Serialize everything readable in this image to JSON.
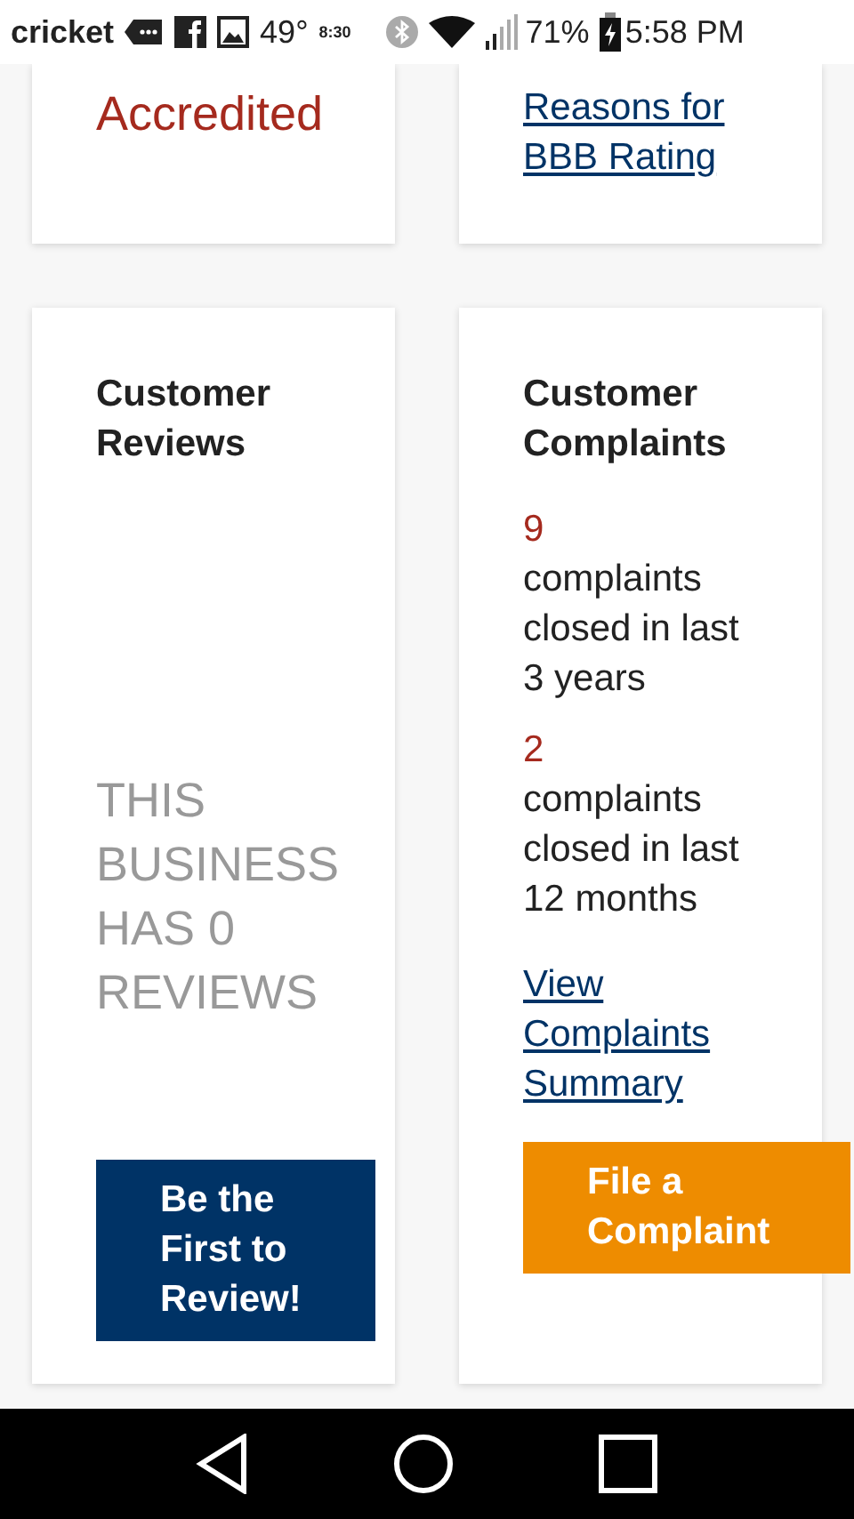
{
  "status_bar": {
    "carrier": "cricket",
    "temperature": "49°",
    "clock_widget": "8:30",
    "battery": "71%",
    "time": "5:58 PM"
  },
  "top_cards": [
    {
      "kind": "status",
      "text": "Accredited"
    },
    {
      "kind": "link",
      "text": "Reasons for BBB Rating"
    }
  ],
  "reviews_card": {
    "title": "Customer Reviews",
    "message": "THIS BUSINESS HAS 0 REVIEWS",
    "button": "Be the First to Review!"
  },
  "complaints_card": {
    "title": "Customer Complaints",
    "stats": [
      {
        "count": "9",
        "text": "complaints closed in last 3 years"
      },
      {
        "count": "2",
        "text": "complaints closed in last 12 months"
      }
    ],
    "link": "View Complaints Summary",
    "button": "File a Complaint"
  }
}
